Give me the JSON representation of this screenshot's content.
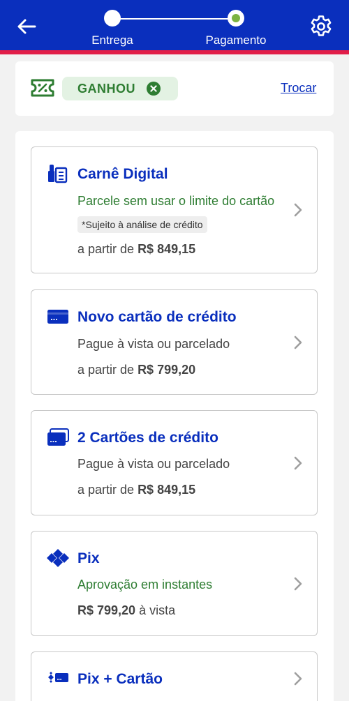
{
  "header": {
    "back_icon": "arrow-left-icon",
    "settings_icon": "gear-icon",
    "steps": [
      {
        "label": "Entrega",
        "state": "done"
      },
      {
        "label": "Pagamento",
        "state": "active"
      }
    ],
    "colors": {
      "header_bg": "#0a2fbd",
      "stripe": "#e11d48",
      "active_step": "#7cb342"
    }
  },
  "coupon": {
    "icon": "ticket-percent-icon",
    "code": "GANHOU",
    "remove_icon": "close-circle-icon",
    "switch_label": "Trocar"
  },
  "payment_options": [
    {
      "title": "Carnê Digital",
      "icon": "carne-icon",
      "subtitle": "Parcele sem usar o limite do cartão",
      "note": "*Sujeito à análise de crédito",
      "price_prefix": "a partir de",
      "price": "R$ 849,15"
    },
    {
      "title": "Novo cartão de crédito",
      "icon": "credit-card-icon",
      "subtitle": "Pague à vista ou parcelado",
      "price_prefix": "a partir de",
      "price": "R$ 799,20"
    },
    {
      "title": "2 Cartões de crédito",
      "icon": "two-cards-icon",
      "subtitle": "Pague à vista ou parcelado",
      "price_prefix": "a partir de",
      "price": "R$ 849,15"
    },
    {
      "title": "Pix",
      "icon": "pix-icon",
      "subtitle": "Aprovação em instantes",
      "price": "R$ 799,20",
      "price_suffix": "à vista"
    },
    {
      "title": "Pix + Cartão",
      "icon": "pix-card-icon"
    }
  ],
  "colors": {
    "brand": "#0a2fbd",
    "success": "#2e7d32",
    "text": "#444444",
    "border": "#c8c8c8"
  }
}
